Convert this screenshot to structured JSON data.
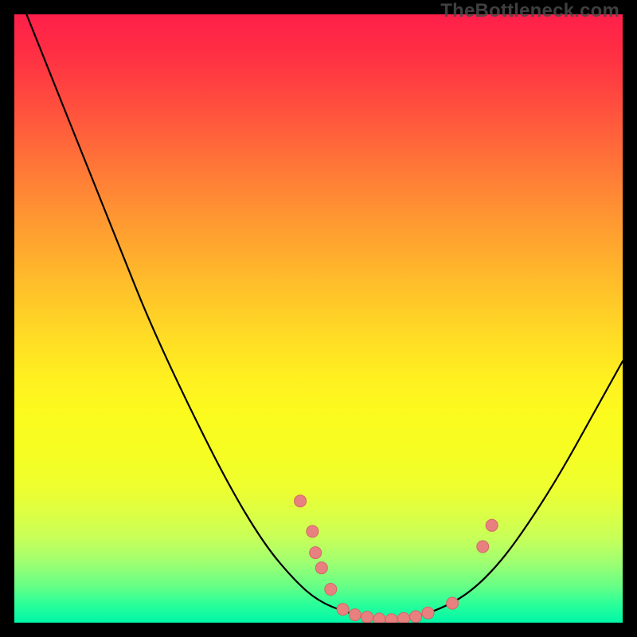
{
  "watermark": "TheBottleneck.com",
  "colors": {
    "gradient_top": "#ff1f4a",
    "gradient_bottom": "#00f7a8",
    "curve_stroke": "#000000",
    "marker_fill": "#e98080",
    "marker_stroke": "#d26666",
    "page_background": "#000000"
  },
  "chart_data": {
    "type": "line",
    "title": "",
    "xlabel": "",
    "ylabel": "",
    "xlim": [
      0,
      100
    ],
    "ylim": [
      0,
      100
    ],
    "curve": [
      {
        "x": 2,
        "y": 100
      },
      {
        "x": 6,
        "y": 90
      },
      {
        "x": 10,
        "y": 80
      },
      {
        "x": 14,
        "y": 70
      },
      {
        "x": 18,
        "y": 60
      },
      {
        "x": 22,
        "y": 50
      },
      {
        "x": 28,
        "y": 37
      },
      {
        "x": 35,
        "y": 23
      },
      {
        "x": 41,
        "y": 13
      },
      {
        "x": 46,
        "y": 7
      },
      {
        "x": 50,
        "y": 3.5
      },
      {
        "x": 55,
        "y": 1.5
      },
      {
        "x": 60,
        "y": 0.6
      },
      {
        "x": 65,
        "y": 0.7
      },
      {
        "x": 70,
        "y": 2.2
      },
      {
        "x": 75,
        "y": 5
      },
      {
        "x": 80,
        "y": 10
      },
      {
        "x": 85,
        "y": 17
      },
      {
        "x": 90,
        "y": 25
      },
      {
        "x": 95,
        "y": 34
      },
      {
        "x": 100,
        "y": 43
      }
    ],
    "markers": [
      {
        "x": 47,
        "y": 20
      },
      {
        "x": 49,
        "y": 15
      },
      {
        "x": 49.5,
        "y": 11.5
      },
      {
        "x": 50.5,
        "y": 9
      },
      {
        "x": 52,
        "y": 5.5
      },
      {
        "x": 54,
        "y": 2.2
      },
      {
        "x": 56,
        "y": 1.3
      },
      {
        "x": 58,
        "y": 0.9
      },
      {
        "x": 60,
        "y": 0.6
      },
      {
        "x": 62,
        "y": 0.5
      },
      {
        "x": 64,
        "y": 0.7
      },
      {
        "x": 66,
        "y": 1.0
      },
      {
        "x": 68,
        "y": 1.6
      },
      {
        "x": 72,
        "y": 3.2
      },
      {
        "x": 77,
        "y": 12.5
      },
      {
        "x": 78.5,
        "y": 16
      }
    ]
  }
}
